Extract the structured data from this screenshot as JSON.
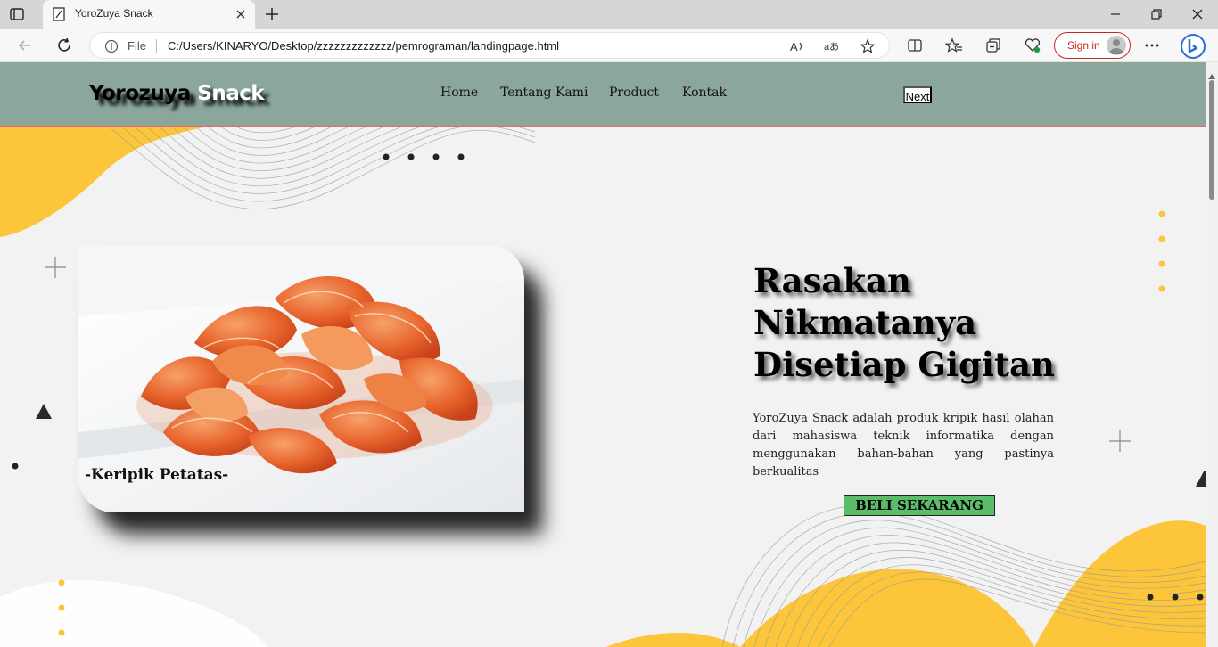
{
  "browser": {
    "tab_title": "YoroZuya Snack",
    "file_label": "File",
    "url": "C:/Users/KINARYO/Desktop/zzzzzzzzzzzzz/pemrograman/landingpage.html",
    "signin_label": "Sign in"
  },
  "header": {
    "logo_part1": "Yorozuya",
    "logo_part2": "Snack",
    "nav": [
      "Home",
      "Tentang Kami",
      "Product",
      "Kontak"
    ],
    "next_label": "Next"
  },
  "product_card": {
    "caption": "-Keripik Petatas-"
  },
  "hero": {
    "title_lines": [
      "Rasakan",
      "Nikmatanya",
      "Disetiap Gigitan"
    ],
    "description": "YoroZuya Snack adalah produk kripik hasil olahan dari mahasiswa teknik informatika dengan menggunakan bahan-bahan yang pastinya berkualitas",
    "cta_label": "BELI SEKARANG"
  },
  "colors": {
    "header_bg": "#8ba79b",
    "header_border": "#e36a6a",
    "accent_yellow": "#fcc53a",
    "cta_green": "#5bbd69"
  },
  "icons": [
    "tab-actions-icon",
    "page-favicon-icon",
    "close-icon",
    "plus-icon",
    "minimize-icon",
    "restore-icon",
    "back-icon",
    "refresh-icon",
    "info-icon",
    "read-aloud-icon",
    "translate-icon",
    "star-icon",
    "split-screen-icon",
    "favorites-icon",
    "collections-icon",
    "browser-essentials-icon",
    "more-icon",
    "bing-icon"
  ]
}
